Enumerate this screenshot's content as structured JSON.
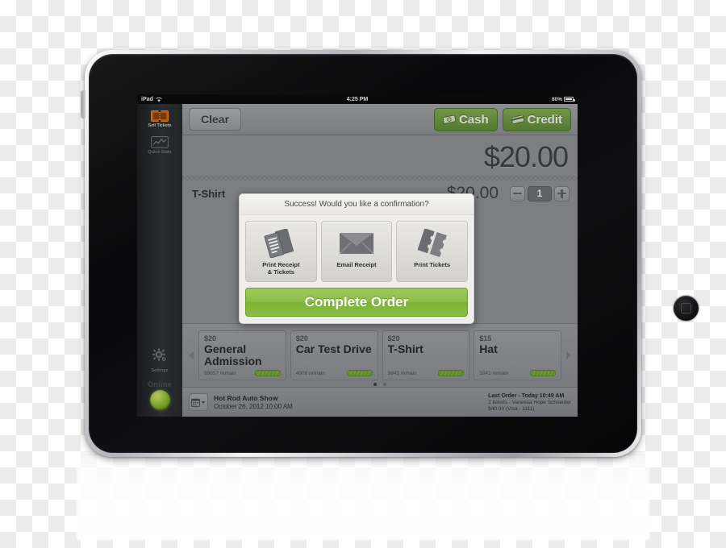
{
  "status_bar": {
    "carrier": "iPad",
    "wifi_icon": "wifi-icon",
    "time": "4:25 PM",
    "battery_percent": "80%",
    "battery_icon": "battery-icon"
  },
  "sidebar": {
    "items": [
      {
        "label": "Sell Tickets",
        "icon": "ticket-icon",
        "active": true
      },
      {
        "label": "Quick Stats",
        "icon": "chart-icon",
        "active": false
      }
    ],
    "settings": {
      "label": "Settings",
      "icon": "gear-icon"
    },
    "connection": {
      "label": "Online",
      "indicator": "status-led-green"
    }
  },
  "toolbar": {
    "clear_label": "Clear",
    "cash_label": "Cash",
    "cash_icon": "banknote-icon",
    "credit_label": "Credit",
    "credit_icon": "credit-card-icon"
  },
  "receipt": {
    "total": "$20.00",
    "line_item": {
      "name": "T-Shirt",
      "price": "$20.00",
      "quantity": "1",
      "minus_label": "−",
      "plus_label": "+"
    }
  },
  "carousel": {
    "prev_icon": "chevron-left-icon",
    "next_icon": "chevron-right-icon",
    "cards": [
      {
        "price": "$20",
        "title": "General Admission",
        "remain": "99857 remain"
      },
      {
        "price": "$20",
        "title": "Car Test Drive",
        "remain": "4908 remain"
      },
      {
        "price": "$20",
        "title": "T-Shirt",
        "remain": "9841 remain"
      },
      {
        "price": "$15",
        "title": "Hat",
        "remain": "5941 remain"
      }
    ],
    "page_dots": {
      "count": 2,
      "active_index": 0
    }
  },
  "footer": {
    "calendar_icon": "calendar-icon",
    "event_name": "Hot Rod Auto Show",
    "event_date": "October 26, 2012 10:00 AM",
    "last_order_title": "Last Order - Today 10:49 AM",
    "last_order_detail": "2 tickets - Vanessa Hope Schneider",
    "last_order_amount": "$40.00 (Visa - 1111)"
  },
  "modal": {
    "header": "Success!  Would you like a confirmation?",
    "options": [
      {
        "label": "Print Receipt\n& Tickets",
        "icon": "receipt-tickets-icon"
      },
      {
        "label": "Email Receipt",
        "icon": "envelope-icon"
      },
      {
        "label": "Print Tickets",
        "icon": "tickets-icon"
      }
    ],
    "complete_label": "Complete Order"
  },
  "device": {
    "home_button": "home-button",
    "side_button": "side-button",
    "camera": "front-camera"
  },
  "colors": {
    "accent_green": "#8bbd45",
    "pay_green": "#6d9c3a",
    "screen_gray": "#8e9094",
    "sidebar_dark": "#26292b"
  }
}
